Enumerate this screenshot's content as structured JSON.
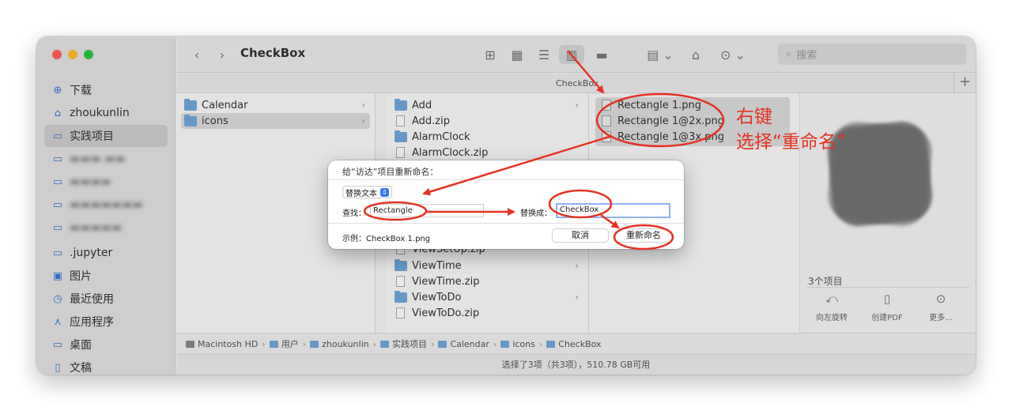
{
  "window": {
    "title": "CheckBox",
    "search_placeholder": "搜索",
    "path_header": "CheckBox"
  },
  "sidebar": {
    "items": [
      {
        "label": "下载",
        "icon": "download-icon",
        "blurred": false
      },
      {
        "label": "zhoukunlin",
        "icon": "home-icon",
        "blurred": false
      },
      {
        "label": "实践项目",
        "icon": "folder-icon",
        "blurred": false,
        "active": true
      },
      {
        "label": "",
        "icon": "folder-icon",
        "blurred": true
      },
      {
        "label": "",
        "icon": "folder-icon",
        "blurred": true
      },
      {
        "label": "",
        "icon": "folder-icon",
        "blurred": true
      },
      {
        "label": "",
        "icon": "folder-icon",
        "blurred": true
      },
      {
        "label": ".jupyter",
        "icon": "folder-icon",
        "blurred": false
      },
      {
        "label": "图片",
        "icon": "photo-icon",
        "blurred": false
      },
      {
        "label": "最近使用",
        "icon": "clock-icon",
        "blurred": false
      },
      {
        "label": "应用程序",
        "icon": "apps-icon",
        "blurred": false
      },
      {
        "label": "桌面",
        "icon": "desktop-icon",
        "blurred": false
      },
      {
        "label": "文稿",
        "icon": "document-icon",
        "blurred": false
      }
    ]
  },
  "columns": {
    "col1": [
      {
        "name": "Calendar",
        "type": "folder",
        "selected": false
      },
      {
        "name": "icons",
        "type": "folder",
        "selected": true
      }
    ],
    "col2": [
      {
        "name": "Add",
        "type": "folder"
      },
      {
        "name": "Add.zip",
        "type": "file"
      },
      {
        "name": "AlarmClock",
        "type": "folder"
      },
      {
        "name": "AlarmClock.zip",
        "type": "file"
      },
      {
        "name": "ViewSetUp.zip",
        "type": "file"
      },
      {
        "name": "ViewTime",
        "type": "folder"
      },
      {
        "name": "ViewTime.zip",
        "type": "file"
      },
      {
        "name": "ViewToDo",
        "type": "folder"
      },
      {
        "name": "ViewToDo.zip",
        "type": "file"
      }
    ],
    "col3": [
      {
        "name": "Rectangle 1.png"
      },
      {
        "name": "Rectangle 1@2x.png"
      },
      {
        "name": "Rectangle 1@3x.png"
      }
    ]
  },
  "preview": {
    "count": "3个项目",
    "actions": [
      {
        "label": "向左旋转",
        "icon": "rotate-left-icon"
      },
      {
        "label": "创建PDF",
        "icon": "pdf-icon"
      },
      {
        "label": "更多...",
        "icon": "more-icon"
      }
    ]
  },
  "pathbar": [
    "Macintosh HD",
    "用户",
    "zhoukunlin",
    "实践项目",
    "Calendar",
    "icons",
    "CheckBox"
  ],
  "status": "选择了3项（共3项），510.78 GB可用",
  "dialog": {
    "title": "给“访达”项目重新命名：",
    "mode": "替换文本",
    "find_label": "查找：",
    "find_value": "Rectangle",
    "replace_label": "替换成：",
    "replace_value": "CheckBox",
    "example": "示例：CheckBox 1.png",
    "cancel": "取消",
    "rename": "重新命名"
  },
  "annotation": {
    "line1": "右键",
    "line2": "选择“重命名”",
    "color": "#e53222"
  }
}
